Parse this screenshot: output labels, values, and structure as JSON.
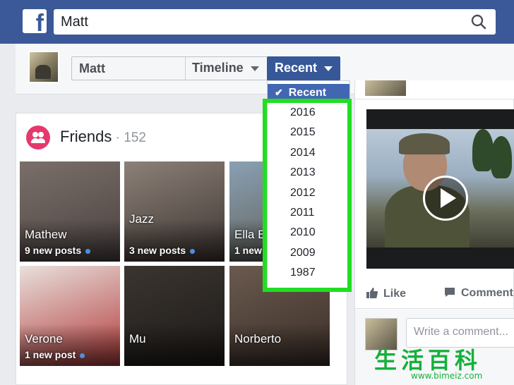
{
  "search": {
    "value": "Matt"
  },
  "filter": {
    "name": "Matt",
    "timeline_label": "Timeline",
    "recent_label": "Recent"
  },
  "menu": {
    "current": "Recent",
    "years": [
      "2016",
      "2015",
      "2014",
      "2013",
      "2012",
      "2011",
      "2010",
      "2009",
      "1987"
    ]
  },
  "friends": {
    "title": "Friends",
    "count": " · 152",
    "tiles": [
      {
        "name": "Mathew",
        "posts": "9 new posts",
        "colors": [
          "#7a6f6a",
          "#4a4240"
        ]
      },
      {
        "name": "Jazz",
        "posts": "3 new posts",
        "colors": [
          "#8c8178",
          "#3e3532"
        ]
      },
      {
        "name": "Ella B",
        "posts": "1 new",
        "colors": [
          "#8aa0b4",
          "#5d5a50"
        ]
      },
      {
        "name": "Verone",
        "posts": "1 new post",
        "colors": [
          "#e8e0dc",
          "#b23a3a"
        ]
      },
      {
        "name": "Mu",
        "posts": "",
        "colors": [
          "#3a3530",
          "#1e1a18"
        ]
      },
      {
        "name": "Norberto",
        "posts": "",
        "colors": [
          "#6a5a4e",
          "#3b2e28"
        ]
      }
    ]
  },
  "video_card": {
    "like_label": "Like",
    "comment_label": "Comment",
    "comment_placeholder": "Write a comment..."
  },
  "watermark": {
    "chars": "生活百科",
    "url": "www.bimeiz.com"
  },
  "colors": {
    "brand": "#3b5998",
    "button": "#365899",
    "menu_selected": "#4267b2",
    "highlight": "#22dd22",
    "friends_icon": "#e4396b",
    "watermark": "#16b03c"
  }
}
